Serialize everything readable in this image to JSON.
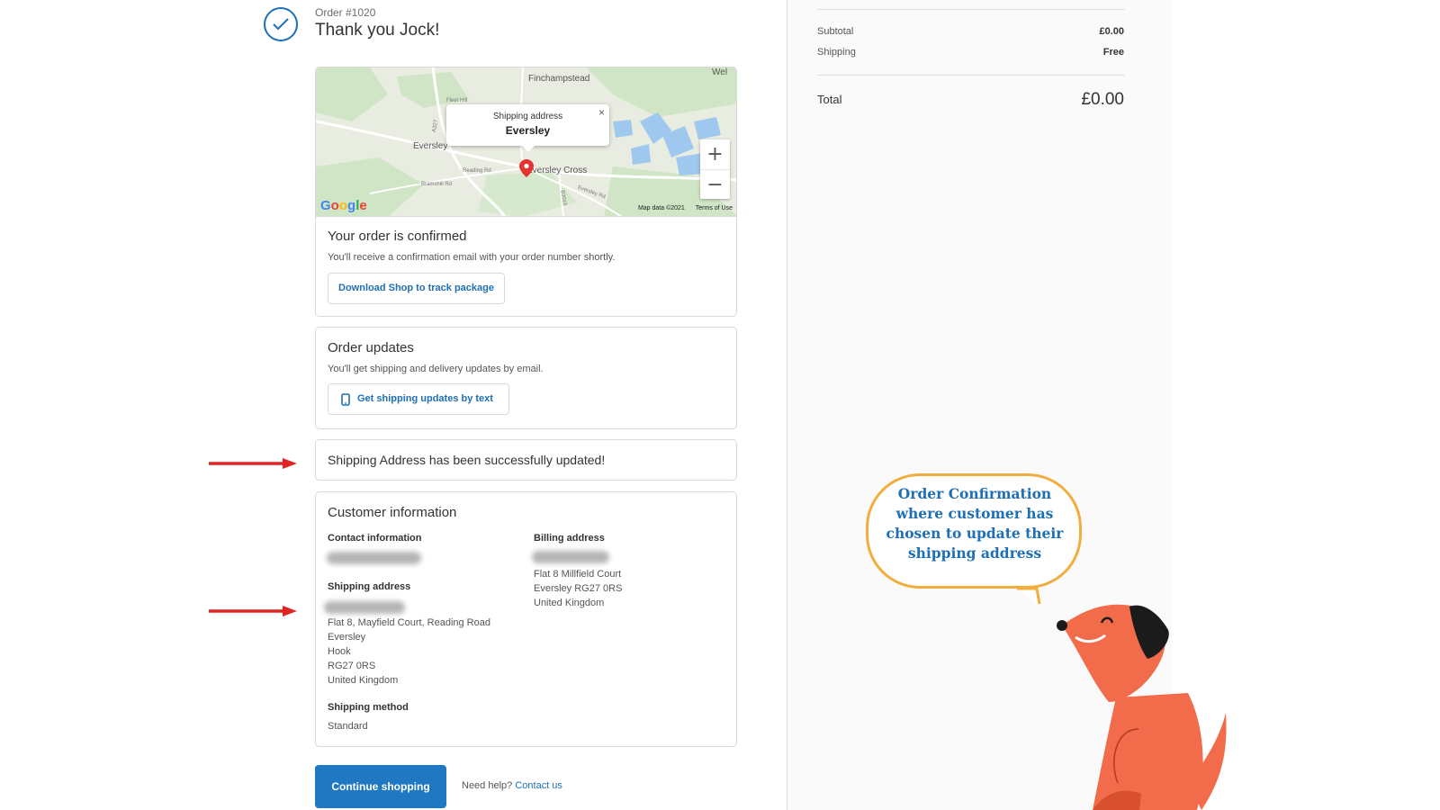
{
  "header": {
    "order_number": "Order #1020",
    "thank_you": "Thank you Jock!"
  },
  "map": {
    "popup_title": "Shipping address",
    "popup_value": "Eversley",
    "places": [
      "Finchampstead",
      "Eversley",
      "Eversley Cross",
      "Wel"
    ],
    "roads": [
      "Fleet Hill",
      "A327",
      "Reading Rd",
      "Bramshill Rd",
      "B3016",
      "Eversley Rd"
    ],
    "zoom_in": "+",
    "zoom_out": "−",
    "close": "×",
    "google": "Google",
    "footer_data": "Map data ©2021",
    "footer_terms": "Terms of Use"
  },
  "confirmed": {
    "title": "Your order is confirmed",
    "text": "You'll receive a confirmation email with your order number shortly.",
    "button": "Download Shop to track package"
  },
  "updates": {
    "title": "Order updates",
    "text": "You'll get shipping and delivery updates by email.",
    "button": "Get shipping updates by text"
  },
  "success": {
    "text": "Shipping Address has been successfully updated!"
  },
  "customer": {
    "title": "Customer information",
    "contact_label": "Contact information",
    "shipping_label": "Shipping address",
    "shipping_lines": [
      "Flat 8, Mayfield Court, Reading Road",
      "Eversley",
      "Hook",
      "RG27 0RS",
      "United Kingdom"
    ],
    "billing_label": "Billing address",
    "billing_lines": [
      "Flat 8 Millfield Court",
      "Eversley RG27 0RS",
      "United Kingdom"
    ],
    "method_label": "Shipping method",
    "method_value": "Standard"
  },
  "footer": {
    "continue": "Continue shopping",
    "help_prefix": "Need help?",
    "help_link": "Contact us"
  },
  "summary": {
    "subtotal_label": "Subtotal",
    "subtotal_value": "£0.00",
    "shipping_label": "Shipping",
    "shipping_value": "Free",
    "total_label": "Total",
    "total_value": "£0.00"
  },
  "annotation": {
    "bubble_text": "Order Confirmation where customer has chosen to update their shipping address"
  },
  "colors": {
    "accent": "#1f6fb5",
    "button": "#1f78c1",
    "arrow": "#e02424",
    "bubble_border": "#f2ad3f",
    "dog": "#f26b4a"
  }
}
